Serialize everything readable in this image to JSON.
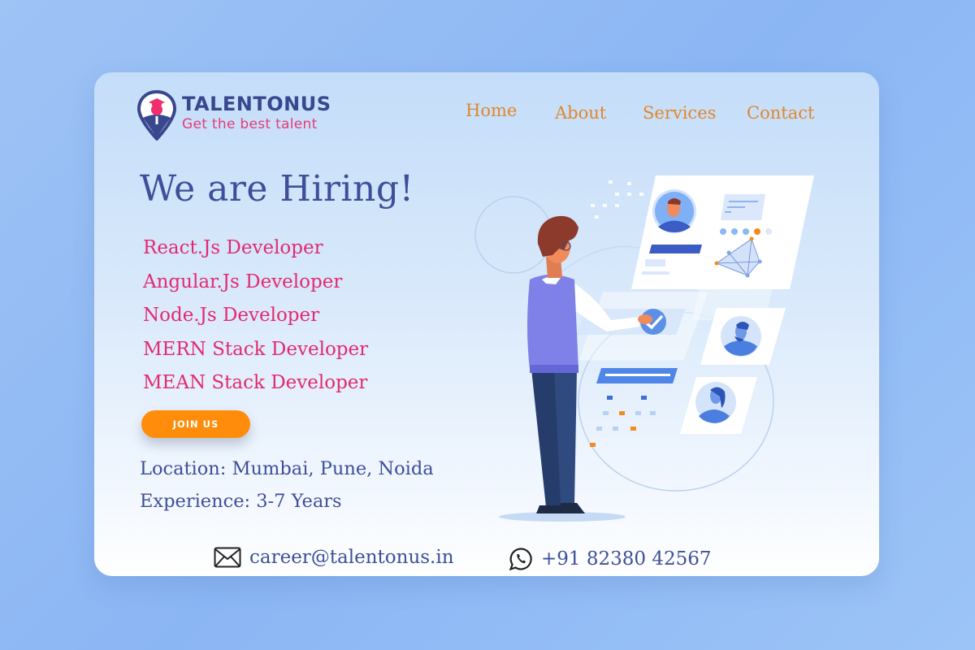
{
  "brand": {
    "name": "TALENTONUS",
    "tagline": "Get the best talent",
    "logo_icon": "map-pin-graduate-icon"
  },
  "nav": {
    "items": [
      {
        "label": "Home"
      },
      {
        "label": "About"
      },
      {
        "label": "Services"
      },
      {
        "label": "Contact"
      }
    ]
  },
  "hero": {
    "headline": "We are Hiring!",
    "roles": [
      "React.Js Developer",
      "Angular.Js Developer",
      "Node.Js Developer",
      "MERN Stack Developer",
      "MEAN Stack Developer"
    ],
    "cta_label": "JOIN US",
    "location": "Location: Mumbai, Pune, Noida",
    "experience": "Experience: 3-7 Years"
  },
  "contact": {
    "email": "career@talentonus.in",
    "email_icon": "envelope-icon",
    "phone": "+91 82380 42567",
    "phone_icon": "whatsapp-icon"
  },
  "illustration": {
    "subject": "man-selecting-candidate-profiles"
  },
  "colors": {
    "brand_navy": "#39478f",
    "accent_pink": "#e22a6f",
    "nav_orange": "#e0872c",
    "cta_orange": "#ff8c0a",
    "page_bg": "#8bb6f4"
  }
}
